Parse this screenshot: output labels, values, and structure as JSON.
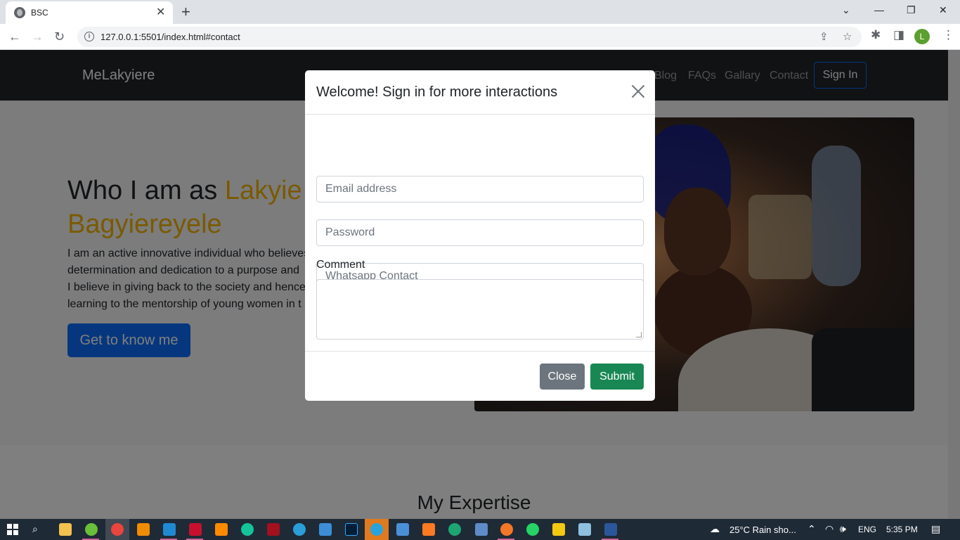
{
  "browser": {
    "tab_title": "BSC",
    "tab_close": "✕",
    "new_tab": "+",
    "url": "127.0.0.1:5501/index.html#contact",
    "profile_initial": "L"
  },
  "navbar": {
    "brand": "MeLakyiere",
    "links": [
      "Blog",
      "FAQs",
      "Gallary",
      "Contact"
    ],
    "signin": "Sign In"
  },
  "hero": {
    "title_plain": "Who I am as ",
    "title_accent_1": "Lakyie",
    "title_accent_2": "Bagyiereyele",
    "lines": [
      "I am an active innovative individual who believes",
      "determination and dedication to a purpose and",
      "I believe in giving back to the society and hence",
      "learning to the mentorship of young women in t"
    ],
    "button": "Get to know me"
  },
  "section2": {
    "heading": "My Expertise"
  },
  "modal": {
    "title": "Welcome! Sign in for more interactions",
    "email_placeholder": "Email address",
    "password_placeholder": "Password",
    "whatsapp_placeholder": "Whatsapp Contact",
    "comment_label": "Comment",
    "close_button": "Close",
    "submit_button": "Submit"
  },
  "taskbar": {
    "weather": "25°C  Rain sho...",
    "language": "ENG",
    "time": "5:35 PM"
  },
  "colors": {
    "accent": "#f4b400",
    "primary": "#0d6efd",
    "success": "#198754",
    "secondary": "#6c757d",
    "navbar": "#212529"
  }
}
